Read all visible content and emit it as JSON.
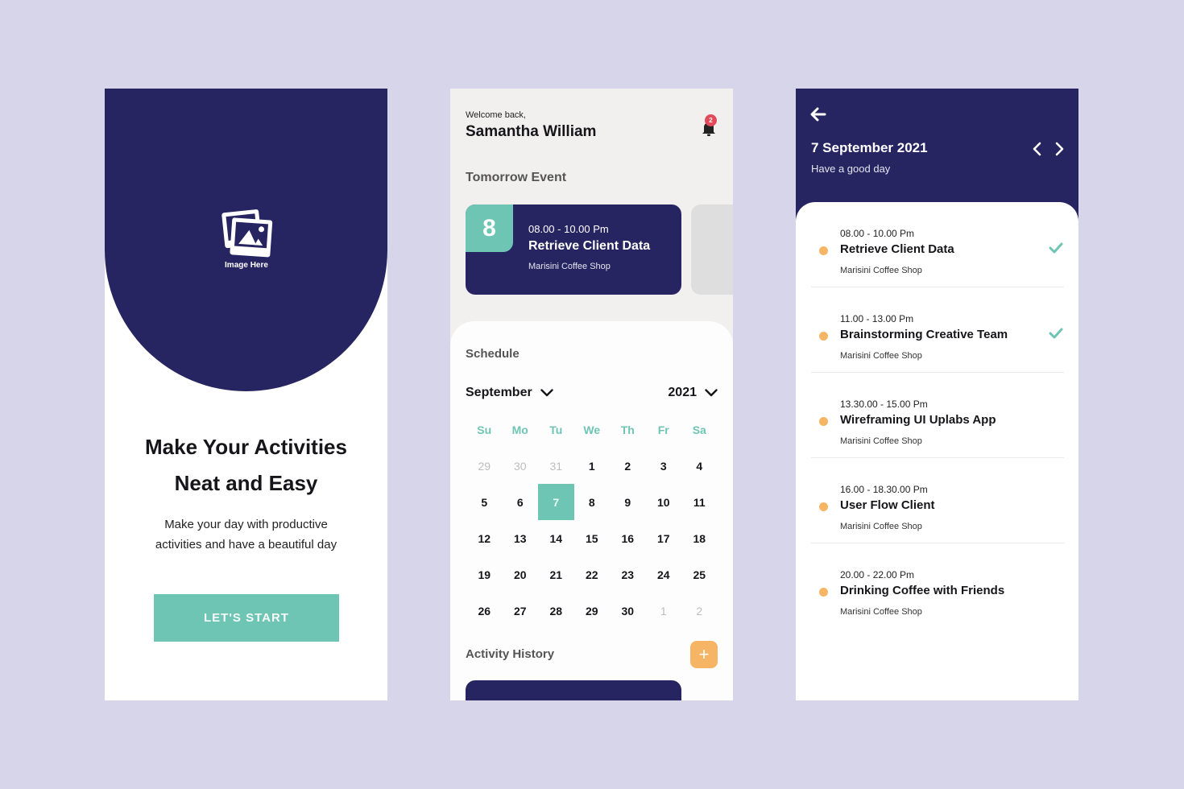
{
  "onboarding": {
    "image_placeholder_label": "Image Here",
    "title_line1": "Make Your Activities",
    "title_line2": "Neat and Easy",
    "subtitle_line1": "Make your day with productive",
    "subtitle_line2": "activities and have a beautiful day",
    "start_button": "LET'S START"
  },
  "dashboard": {
    "welcome": "Welcome back,",
    "user_name": "Samantha William",
    "notification_count": "2",
    "tomorrow_title": "Tomorrow Event",
    "tomorrow_event": {
      "day": "8",
      "time": "08.00 - 10.00 Pm",
      "title": "Retrieve Client Data",
      "place": "Marisini Coffee Shop"
    },
    "schedule_title": "Schedule",
    "month": "September",
    "year": "2021",
    "weekdays": [
      "Su",
      "Mo",
      "Tu",
      "We",
      "Th",
      "Fr",
      "Sa"
    ],
    "weeks": [
      [
        {
          "d": "29",
          "m": true
        },
        {
          "d": "30",
          "m": true
        },
        {
          "d": "31",
          "m": true
        },
        {
          "d": "1"
        },
        {
          "d": "2"
        },
        {
          "d": "3"
        },
        {
          "d": "4"
        }
      ],
      [
        {
          "d": "5"
        },
        {
          "d": "6"
        },
        {
          "d": "7",
          "sel": true
        },
        {
          "d": "8"
        },
        {
          "d": "9"
        },
        {
          "d": "10"
        },
        {
          "d": "11"
        }
      ],
      [
        {
          "d": "12"
        },
        {
          "d": "13"
        },
        {
          "d": "14"
        },
        {
          "d": "15"
        },
        {
          "d": "16"
        },
        {
          "d": "17"
        },
        {
          "d": "18"
        }
      ],
      [
        {
          "d": "19"
        },
        {
          "d": "20"
        },
        {
          "d": "21"
        },
        {
          "d": "22"
        },
        {
          "d": "23"
        },
        {
          "d": "24"
        },
        {
          "d": "25"
        }
      ],
      [
        {
          "d": "26"
        },
        {
          "d": "27"
        },
        {
          "d": "28"
        },
        {
          "d": "29"
        },
        {
          "d": "30"
        },
        {
          "d": "1",
          "m": true
        },
        {
          "d": "2",
          "m": true
        }
      ]
    ],
    "activity_history_title": "Activity History",
    "add_button": "+"
  },
  "day_view": {
    "date": "7 September 2021",
    "greeting": "Have a good day",
    "events": [
      {
        "time": "08.00 - 10.00 Pm",
        "title": "Retrieve Client Data",
        "place": "Marisini Coffee Shop",
        "done": true
      },
      {
        "time": "11.00 - 13.00 Pm",
        "title": "Brainstorming Creative Team",
        "place": "Marisini Coffee Shop",
        "done": true
      },
      {
        "time": "13.30.00 - 15.00 Pm",
        "title": "Wireframing UI Uplabs App",
        "place": "Marisini Coffee Shop",
        "done": false
      },
      {
        "time": "16.00 - 18.30.00 Pm",
        "title": "User Flow Client",
        "place": "Marisini Coffee Shop",
        "done": false
      },
      {
        "time": "20.00 - 22.00 Pm",
        "title": "Drinking Coffee with Friends",
        "place": "Marisini Coffee Shop",
        "done": false
      }
    ]
  },
  "colors": {
    "background": "#d6d5ea",
    "navy": "#272561",
    "teal": "#6fc5b4",
    "orange": "#f6b565",
    "badge_red": "#e24a5a"
  }
}
